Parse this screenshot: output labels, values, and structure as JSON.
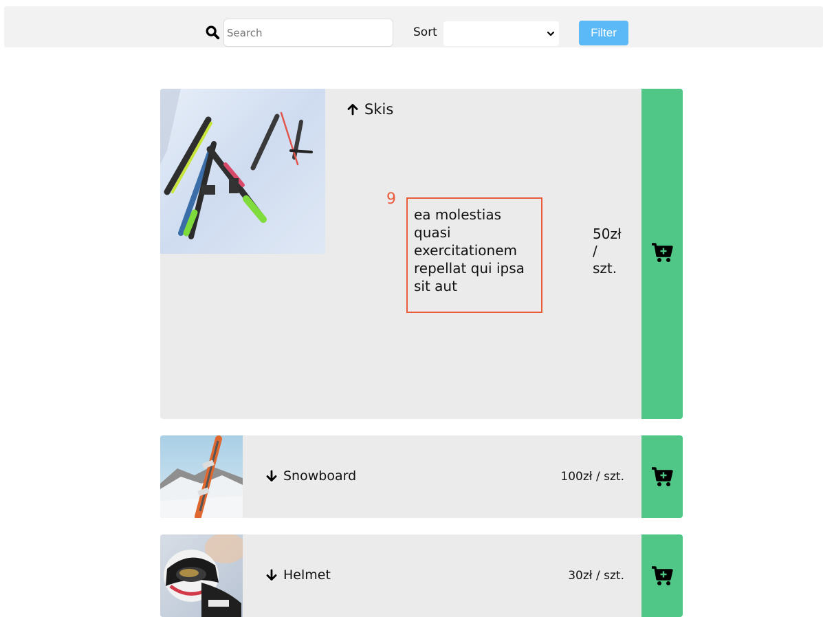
{
  "toolbar": {
    "search_icon": "search-icon",
    "search_placeholder": "Search",
    "search_value": "",
    "sort_label": "Sort",
    "sort_selected": "",
    "filter_label": "Filter"
  },
  "colors": {
    "toolbar_bg": "#f2f2f2",
    "card_bg": "#ebebeb",
    "cart_green": "#50c787",
    "filter_blue": "#5cb9f7",
    "highlight_red": "#ea5b3a"
  },
  "products": [
    {
      "name": "Skis",
      "arrow": "arrow-up-icon",
      "expanded": true,
      "index_label": "9",
      "description": "ea molestias quasi exercitationem repellat qui ipsa sit aut",
      "price_line1": "50zł",
      "price_line2": "/",
      "price_line3": "szt.",
      "cart_icon": "cart-plus-icon"
    },
    {
      "name": "Snowboard",
      "arrow": "arrow-down-icon",
      "expanded": false,
      "price": "100zł / szt.",
      "cart_icon": "cart-plus-icon"
    },
    {
      "name": "Helmet",
      "arrow": "arrow-down-icon",
      "expanded": false,
      "price": "30zł / szt.",
      "cart_icon": "cart-plus-icon"
    }
  ]
}
